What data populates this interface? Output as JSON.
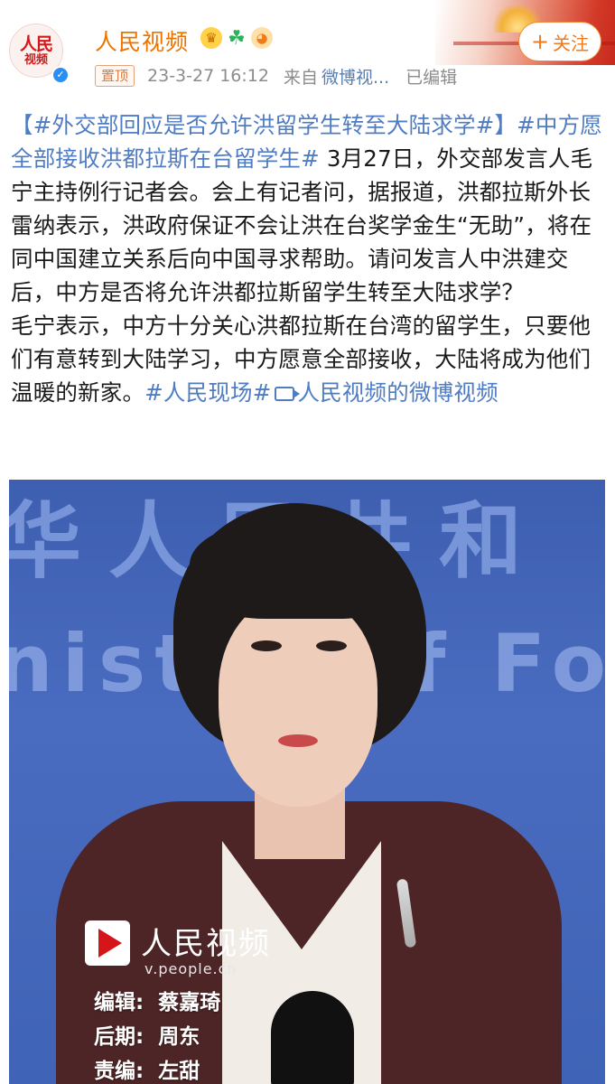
{
  "header": {
    "username": "人民视频",
    "avatar": {
      "line1": "人民",
      "line2": "视频"
    },
    "badges": [
      "crown-icon",
      "clover-icon",
      "fish-icon"
    ],
    "follow_label": "关注",
    "pin_label": "置顶",
    "time": "23-3-27 16:12",
    "from_label": "来自",
    "source": "微博视...",
    "edited": "已编辑"
  },
  "post": {
    "tag1": "【#外交部回应是否允许洪留学生转至大陆求学#】",
    "tag2": "#中方愿全部接收洪都拉斯在台留学生#",
    "para1": " 3月27日，外交部发言人毛宁主持例行记者会。会上有记者问，据报道，洪都拉斯外长雷纳表示，洪政府保证不会让洪在台奖学金生“无助”，将在同中国建立关系后向中国寻求帮助。请问发言人中洪建交后，中方是否将允许洪都拉斯留学生转至大陆求学？",
    "para2": "毛宁表示，中方十分关心洪都拉斯在台湾的留学生，只要他们有意转到大陆学习，中方愿意全部接收，大陆将成为他们温暖的新家。",
    "tag3": "#人民现场#",
    "video_link": "人民视频的微博视频"
  },
  "video": {
    "bg_text_cn": "华人民共和",
    "bg_text_en": "nistry of Fore",
    "logo_text": "人民视频",
    "logo_sub": "v.people.cn",
    "credits": [
      {
        "key": "编辑:",
        "value": "蔡嘉琦"
      },
      {
        "key": "后期:",
        "value": "周东"
      },
      {
        "key": "责编:",
        "value": "左甜"
      }
    ]
  },
  "colors": {
    "accent_orange": "#eb7300",
    "link_blue": "#4f7cc3",
    "brand_red": "#d11a1a",
    "verified_blue": "#2a8ff4"
  }
}
